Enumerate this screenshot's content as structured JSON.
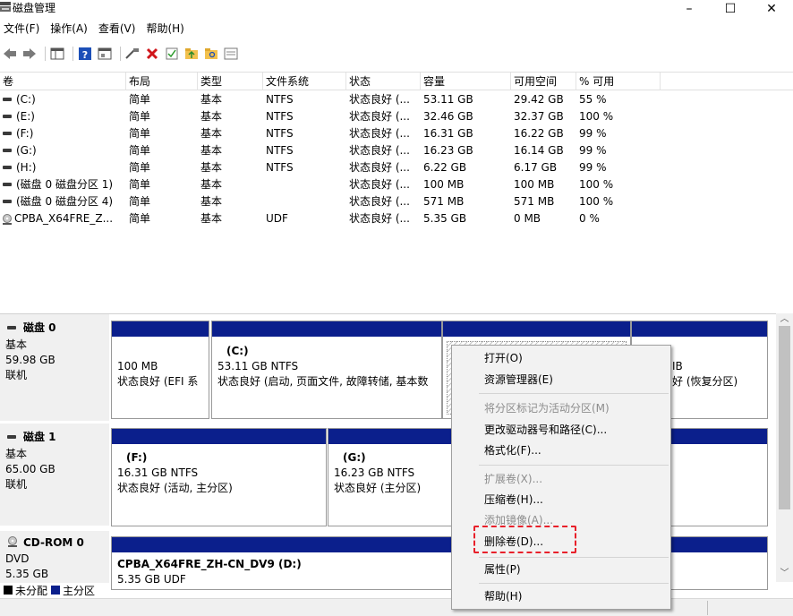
{
  "window": {
    "title": "磁盘管理",
    "minimize_glyph": "–",
    "maximize_glyph": "☐",
    "close_glyph": "✕"
  },
  "menubar": {
    "items": [
      "文件(F)",
      "操作(A)",
      "查看(V)",
      "帮助(H)"
    ]
  },
  "toolbar": {
    "icons": [
      "back-arrow-icon",
      "forward-arrow-icon",
      "list-view-icon",
      "help-icon",
      "properties-icon",
      "connect-icon",
      "delete-icon",
      "check-icon",
      "folder-up-icon",
      "folder-search-icon",
      "console-icon"
    ]
  },
  "volume_table": {
    "columns": [
      "卷",
      "布局",
      "类型",
      "文件系统",
      "状态",
      "容量",
      "可用空间",
      "% 可用"
    ],
    "rows": [
      {
        "vol": "(C:)",
        "layout": "简单",
        "type": "基本",
        "fs": "NTFS",
        "status": "状态良好 (...",
        "cap": "53.11 GB",
        "free": "29.42 GB",
        "pct": "55 %",
        "icon": "drive"
      },
      {
        "vol": "(E:)",
        "layout": "简单",
        "type": "基本",
        "fs": "NTFS",
        "status": "状态良好 (...",
        "cap": "32.46 GB",
        "free": "32.37 GB",
        "pct": "100 %",
        "icon": "drive"
      },
      {
        "vol": "(F:)",
        "layout": "简单",
        "type": "基本",
        "fs": "NTFS",
        "status": "状态良好 (...",
        "cap": "16.31 GB",
        "free": "16.22 GB",
        "pct": "99 %",
        "icon": "drive"
      },
      {
        "vol": "(G:)",
        "layout": "简单",
        "type": "基本",
        "fs": "NTFS",
        "status": "状态良好 (...",
        "cap": "16.23 GB",
        "free": "16.14 GB",
        "pct": "99 %",
        "icon": "drive"
      },
      {
        "vol": "(H:)",
        "layout": "简单",
        "type": "基本",
        "fs": "NTFS",
        "status": "状态良好 (...",
        "cap": "6.22 GB",
        "free": "6.17 GB",
        "pct": "99 %",
        "icon": "drive"
      },
      {
        "vol": "(磁盘 0 磁盘分区 1)",
        "layout": "简单",
        "type": "基本",
        "fs": "",
        "status": "状态良好 (...",
        "cap": "100 MB",
        "free": "100 MB",
        "pct": "100 %",
        "icon": "drive"
      },
      {
        "vol": "(磁盘 0 磁盘分区 4)",
        "layout": "简单",
        "type": "基本",
        "fs": "",
        "status": "状态良好 (...",
        "cap": "571 MB",
        "free": "571 MB",
        "pct": "100 %",
        "icon": "drive"
      },
      {
        "vol": "CPBA_X64FRE_Z...",
        "layout": "简单",
        "type": "基本",
        "fs": "UDF",
        "status": "状态良好 (...",
        "cap": "5.35 GB",
        "free": "0 MB",
        "pct": "0 %",
        "icon": "cd"
      }
    ]
  },
  "disks": [
    {
      "name": "磁盘 0",
      "kind": "基本",
      "size": "59.98 GB",
      "state": "联机",
      "partitions": [
        {
          "label": "",
          "line1": "100 MB",
          "line2": "状态良好 (EFI 系"
        },
        {
          "label": "(C:)",
          "line1": "53.11 GB NTFS",
          "line2": "状态良好 (启动, 页面文件, 故障转储, 基本数"
        },
        {
          "label": "",
          "line1": "",
          "line2": ""
        },
        {
          "label": "",
          "line1": "IB",
          "line2": "好 (恢复分区)"
        }
      ]
    },
    {
      "name": "磁盘 1",
      "kind": "基本",
      "size": "65.00 GB",
      "state": "联机",
      "partitions": [
        {
          "label": "(F:)",
          "line1": "16.31 GB NTFS",
          "line2": "状态良好 (活动, 主分区)"
        },
        {
          "label": "(G:)",
          "line1": "16.23 GB NTFS",
          "line2": "状态良好 (主分区)"
        }
      ]
    },
    {
      "name": "CD-ROM 0",
      "kind": "DVD",
      "size": "5.35 GB",
      "partitions": [
        {
          "label": "CPBA_X64FRE_ZH-CN_DV9  (D:)",
          "line1": "5.35 GB UDF"
        }
      ]
    }
  ],
  "legend": {
    "unallocated": "未分配",
    "primary": "主分区",
    "unallocated_color": "#000000",
    "primary_color": "#0b1f8c"
  },
  "context_menu": {
    "items": [
      {
        "label": "打开(O)",
        "enabled": true
      },
      {
        "label": "资源管理器(E)",
        "enabled": true
      },
      {
        "label": "将分区标记为活动分区(M)",
        "enabled": false
      },
      {
        "label": "更改驱动器号和路径(C)...",
        "enabled": true
      },
      {
        "label": "格式化(F)...",
        "enabled": true
      },
      {
        "label": "扩展卷(X)...",
        "enabled": false
      },
      {
        "label": "压缩卷(H)...",
        "enabled": true
      },
      {
        "label": "添加镜像(A)...",
        "enabled": false
      },
      {
        "label": "删除卷(D)...",
        "enabled": true,
        "highlighted": true
      },
      {
        "label": "属性(P)",
        "enabled": true
      },
      {
        "label": "帮助(H)",
        "enabled": true
      }
    ],
    "highlight_color": "#e8202a"
  }
}
